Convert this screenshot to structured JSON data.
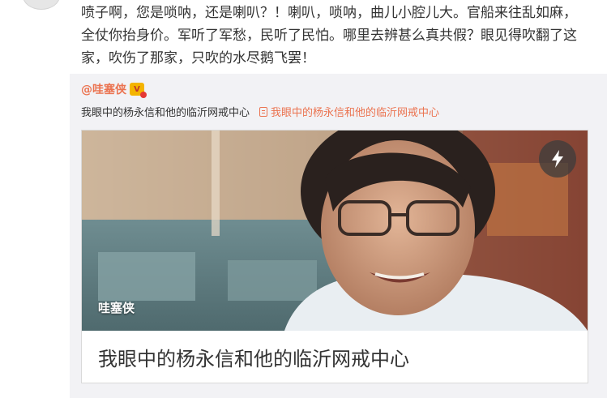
{
  "post": {
    "text": "喷子啊，您是唢呐，还是喇叭？！喇叭，唢呐，曲儿小腔儿大。官船来往乱如麻，全仗你抬身价。军听了军愁，民听了民怕。哪里去辨甚么真共假？眼见得吹翻了这家，吹伤了那家，只吹的水尽鹅飞罢！"
  },
  "repost": {
    "author": "@哇塞侠",
    "body": "我眼中的杨永信和他的临沂网戒中心",
    "link_label": "我眼中的杨永信和他的临沂网戒中心",
    "card": {
      "watermark": "哇塞侠",
      "title": "我眼中的杨永信和他的临沂网戒中心"
    }
  },
  "icons": {
    "vip": "vip-badge-icon",
    "link": "web-link-icon",
    "play": "lightning-play-icon"
  },
  "colors": {
    "link_orange": "#eb7350",
    "repost_bg": "#f2f2f5",
    "text": "#333333"
  }
}
